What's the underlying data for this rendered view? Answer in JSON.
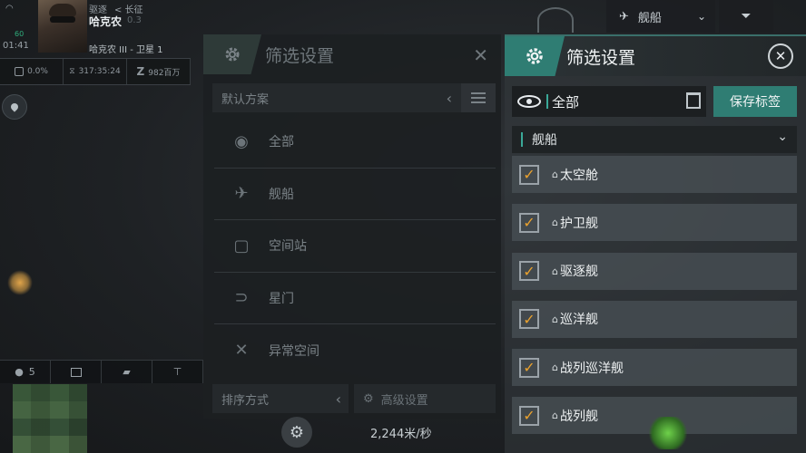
{
  "hud": {
    "rank": "驱逐",
    "corp": "< 长征",
    "name": "哈克农",
    "sec": "0.3",
    "wifi": "60",
    "time": "01:41",
    "location": "哈克农 III - 卫星 1",
    "stats": [
      "0.0%",
      "317:35:24",
      "982百万"
    ]
  },
  "chat": {
    "count": "5"
  },
  "top_nav": {
    "label": "舰船"
  },
  "left_panel": {
    "title": "筛选设置",
    "scheme": "默认方案",
    "items": [
      "全部",
      "舰船",
      "空间站",
      "星门",
      "异常空间"
    ],
    "sort_label": "排序方式",
    "advanced_label": "高级设置"
  },
  "right_panel": {
    "title": "筛选设置",
    "search_value": "全部",
    "save_label": "保存标签",
    "category": "舰船",
    "items": [
      "太空舱",
      "护卫舰",
      "驱逐舰",
      "巡洋舰",
      "战列巡洋舰",
      "战列舰"
    ]
  },
  "speed": "2,244米/秒",
  "colors": {
    "accent": "#2f7d73",
    "check": "#e9a12e"
  }
}
